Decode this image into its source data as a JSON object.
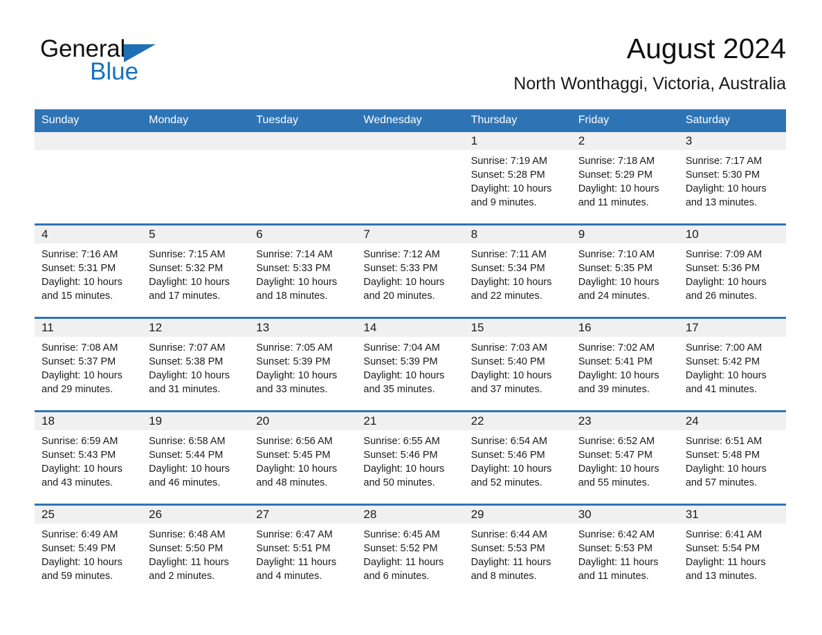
{
  "brand": {
    "name_part1": "General",
    "name_part2": "Blue",
    "triangle_icon": "brand-triangle-icon",
    "colors": {
      "black": "#111111",
      "blue": "#1372c0",
      "triangle_blue": "#1f6fb4"
    }
  },
  "header": {
    "title": "August 2024",
    "subtitle": "North Wonthaggi, Victoria, Australia"
  },
  "calendar": {
    "header_bg": "#2e74b5",
    "day_band_bg": "#f0f0f0",
    "day_names": [
      "Sunday",
      "Monday",
      "Tuesday",
      "Wednesday",
      "Thursday",
      "Friday",
      "Saturday"
    ],
    "labels": {
      "sunrise": "Sunrise:",
      "sunset": "Sunset:",
      "daylight": "Daylight:"
    },
    "weeks": [
      [
        {
          "day": "",
          "empty": true
        },
        {
          "day": "",
          "empty": true
        },
        {
          "day": "",
          "empty": true
        },
        {
          "day": "",
          "empty": true
        },
        {
          "day": "1",
          "sunrise": "Sunrise: 7:19 AM",
          "sunset": "Sunset: 5:28 PM",
          "daylight": "Daylight: 10 hours and 9 minutes."
        },
        {
          "day": "2",
          "sunrise": "Sunrise: 7:18 AM",
          "sunset": "Sunset: 5:29 PM",
          "daylight": "Daylight: 10 hours and 11 minutes."
        },
        {
          "day": "3",
          "sunrise": "Sunrise: 7:17 AM",
          "sunset": "Sunset: 5:30 PM",
          "daylight": "Daylight: 10 hours and 13 minutes."
        }
      ],
      [
        {
          "day": "4",
          "sunrise": "Sunrise: 7:16 AM",
          "sunset": "Sunset: 5:31 PM",
          "daylight": "Daylight: 10 hours and 15 minutes."
        },
        {
          "day": "5",
          "sunrise": "Sunrise: 7:15 AM",
          "sunset": "Sunset: 5:32 PM",
          "daylight": "Daylight: 10 hours and 17 minutes."
        },
        {
          "day": "6",
          "sunrise": "Sunrise: 7:14 AM",
          "sunset": "Sunset: 5:33 PM",
          "daylight": "Daylight: 10 hours and 18 minutes."
        },
        {
          "day": "7",
          "sunrise": "Sunrise: 7:12 AM",
          "sunset": "Sunset: 5:33 PM",
          "daylight": "Daylight: 10 hours and 20 minutes."
        },
        {
          "day": "8",
          "sunrise": "Sunrise: 7:11 AM",
          "sunset": "Sunset: 5:34 PM",
          "daylight": "Daylight: 10 hours and 22 minutes."
        },
        {
          "day": "9",
          "sunrise": "Sunrise: 7:10 AM",
          "sunset": "Sunset: 5:35 PM",
          "daylight": "Daylight: 10 hours and 24 minutes."
        },
        {
          "day": "10",
          "sunrise": "Sunrise: 7:09 AM",
          "sunset": "Sunset: 5:36 PM",
          "daylight": "Daylight: 10 hours and 26 minutes."
        }
      ],
      [
        {
          "day": "11",
          "sunrise": "Sunrise: 7:08 AM",
          "sunset": "Sunset: 5:37 PM",
          "daylight": "Daylight: 10 hours and 29 minutes."
        },
        {
          "day": "12",
          "sunrise": "Sunrise: 7:07 AM",
          "sunset": "Sunset: 5:38 PM",
          "daylight": "Daylight: 10 hours and 31 minutes."
        },
        {
          "day": "13",
          "sunrise": "Sunrise: 7:05 AM",
          "sunset": "Sunset: 5:39 PM",
          "daylight": "Daylight: 10 hours and 33 minutes."
        },
        {
          "day": "14",
          "sunrise": "Sunrise: 7:04 AM",
          "sunset": "Sunset: 5:39 PM",
          "daylight": "Daylight: 10 hours and 35 minutes."
        },
        {
          "day": "15",
          "sunrise": "Sunrise: 7:03 AM",
          "sunset": "Sunset: 5:40 PM",
          "daylight": "Daylight: 10 hours and 37 minutes."
        },
        {
          "day": "16",
          "sunrise": "Sunrise: 7:02 AM",
          "sunset": "Sunset: 5:41 PM",
          "daylight": "Daylight: 10 hours and 39 minutes."
        },
        {
          "day": "17",
          "sunrise": "Sunrise: 7:00 AM",
          "sunset": "Sunset: 5:42 PM",
          "daylight": "Daylight: 10 hours and 41 minutes."
        }
      ],
      [
        {
          "day": "18",
          "sunrise": "Sunrise: 6:59 AM",
          "sunset": "Sunset: 5:43 PM",
          "daylight": "Daylight: 10 hours and 43 minutes."
        },
        {
          "day": "19",
          "sunrise": "Sunrise: 6:58 AM",
          "sunset": "Sunset: 5:44 PM",
          "daylight": "Daylight: 10 hours and 46 minutes."
        },
        {
          "day": "20",
          "sunrise": "Sunrise: 6:56 AM",
          "sunset": "Sunset: 5:45 PM",
          "daylight": "Daylight: 10 hours and 48 minutes."
        },
        {
          "day": "21",
          "sunrise": "Sunrise: 6:55 AM",
          "sunset": "Sunset: 5:46 PM",
          "daylight": "Daylight: 10 hours and 50 minutes."
        },
        {
          "day": "22",
          "sunrise": "Sunrise: 6:54 AM",
          "sunset": "Sunset: 5:46 PM",
          "daylight": "Daylight: 10 hours and 52 minutes."
        },
        {
          "day": "23",
          "sunrise": "Sunrise: 6:52 AM",
          "sunset": "Sunset: 5:47 PM",
          "daylight": "Daylight: 10 hours and 55 minutes."
        },
        {
          "day": "24",
          "sunrise": "Sunrise: 6:51 AM",
          "sunset": "Sunset: 5:48 PM",
          "daylight": "Daylight: 10 hours and 57 minutes."
        }
      ],
      [
        {
          "day": "25",
          "sunrise": "Sunrise: 6:49 AM",
          "sunset": "Sunset: 5:49 PM",
          "daylight": "Daylight: 10 hours and 59 minutes."
        },
        {
          "day": "26",
          "sunrise": "Sunrise: 6:48 AM",
          "sunset": "Sunset: 5:50 PM",
          "daylight": "Daylight: 11 hours and 2 minutes."
        },
        {
          "day": "27",
          "sunrise": "Sunrise: 6:47 AM",
          "sunset": "Sunset: 5:51 PM",
          "daylight": "Daylight: 11 hours and 4 minutes."
        },
        {
          "day": "28",
          "sunrise": "Sunrise: 6:45 AM",
          "sunset": "Sunset: 5:52 PM",
          "daylight": "Daylight: 11 hours and 6 minutes."
        },
        {
          "day": "29",
          "sunrise": "Sunrise: 6:44 AM",
          "sunset": "Sunset: 5:53 PM",
          "daylight": "Daylight: 11 hours and 8 minutes."
        },
        {
          "day": "30",
          "sunrise": "Sunrise: 6:42 AM",
          "sunset": "Sunset: 5:53 PM",
          "daylight": "Daylight: 11 hours and 11 minutes."
        },
        {
          "day": "31",
          "sunrise": "Sunrise: 6:41 AM",
          "sunset": "Sunset: 5:54 PM",
          "daylight": "Daylight: 11 hours and 13 minutes."
        }
      ]
    ]
  }
}
